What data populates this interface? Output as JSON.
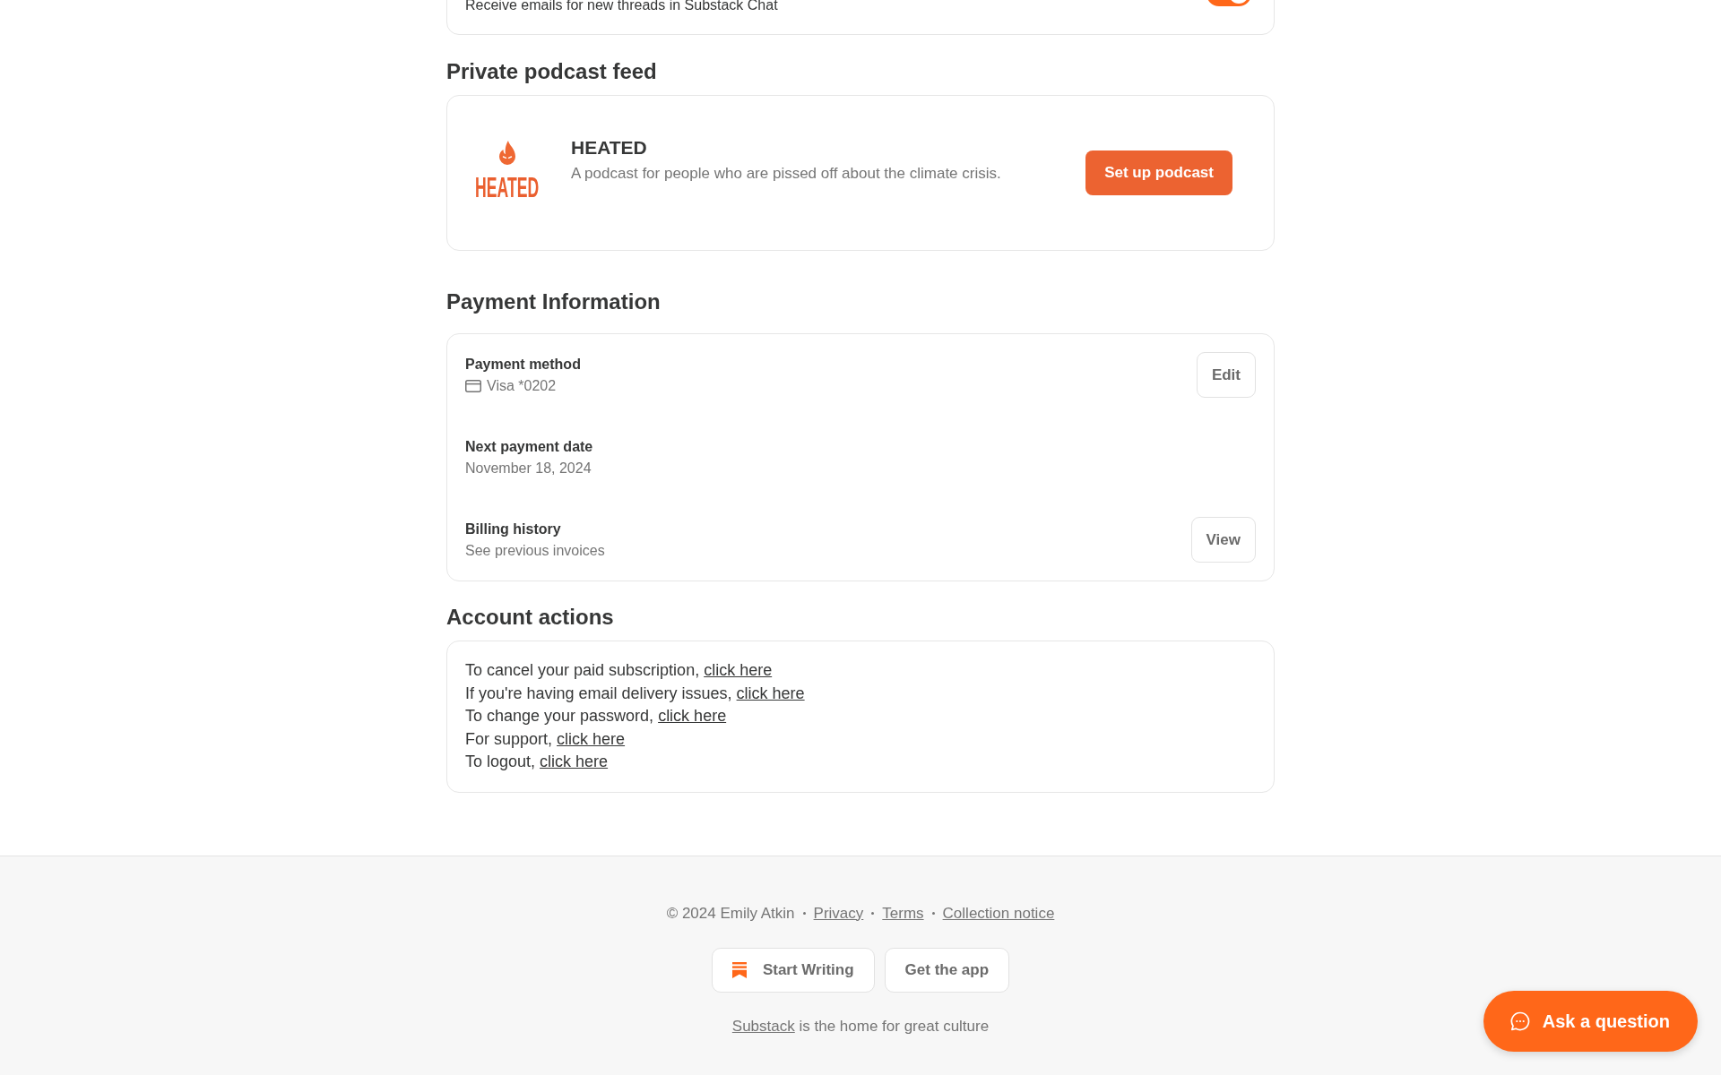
{
  "notification_card": {
    "description": "Receive emails for new threads in Substack Chat",
    "toggle": {
      "on": true
    }
  },
  "podcast_section": {
    "heading": "Private podcast feed",
    "podcast": {
      "logo_text": "HEATED",
      "title": "HEATED",
      "description": "A podcast for people who are pissed off about the climate crisis.",
      "button": "Set up podcast"
    }
  },
  "payment_section": {
    "heading": "Payment Information",
    "rows": [
      {
        "kind": "card",
        "label": "Payment method",
        "value": "Visa *0202",
        "button": "Edit"
      },
      {
        "kind": "text",
        "label": "Next payment date",
        "value": "November 18, 2024"
      },
      {
        "kind": "text",
        "label": "Billing history",
        "value": "See previous invoices",
        "button": "View"
      }
    ]
  },
  "account_section": {
    "heading": "Account actions",
    "actions": [
      {
        "text": "To cancel your paid subscription,",
        "link": "click here"
      },
      {
        "text": "If you're having email delivery issues,",
        "link": "click here"
      },
      {
        "text": "To change your password,",
        "link": "click here"
      },
      {
        "text": "For support,",
        "link": "click here"
      },
      {
        "text": "To logout,",
        "link": "click here"
      }
    ]
  },
  "footer": {
    "copyright": "© 2024 Emily Atkin",
    "links": [
      "Privacy",
      "Terms",
      "Collection notice"
    ],
    "buttons": [
      {
        "kind": "logo",
        "label": "Start Writing"
      },
      {
        "kind": "plain",
        "label": "Get the app"
      }
    ],
    "tagline": {
      "link": "Substack",
      "text": "is the home for great culture"
    }
  },
  "ask_button": {
    "label": "Ask a question"
  }
}
